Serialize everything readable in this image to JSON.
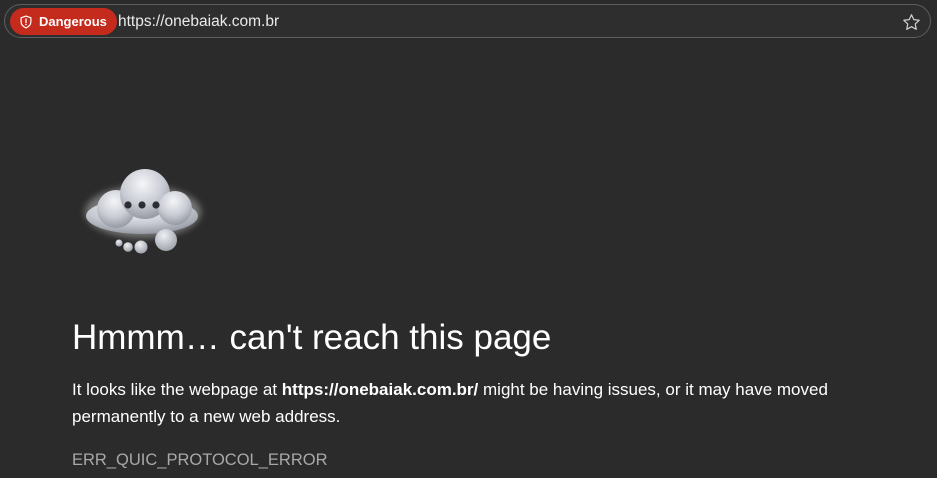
{
  "address_bar": {
    "security_badge": {
      "label": "Dangerous",
      "icon": "shield-icon",
      "color": "#c42b1c"
    },
    "url": "https://onebaiak.com.br",
    "favorite_icon": "star-outline-icon"
  },
  "error_page": {
    "illustration": "thinking-cloud-icon",
    "headline": "Hmmm… can't reach this page",
    "description": {
      "prefix": "It looks like the webpage at ",
      "url": "https://onebaiak.com.br/",
      "suffix": " might be having issues, or it may have moved permanently to a new web address."
    },
    "error_code": "ERR_QUIC_PROTOCOL_ERROR"
  },
  "colors": {
    "background": "#2b2b2b",
    "danger": "#c42b1c",
    "text_primary": "#ffffff",
    "text_secondary": "#a8a8a8"
  }
}
